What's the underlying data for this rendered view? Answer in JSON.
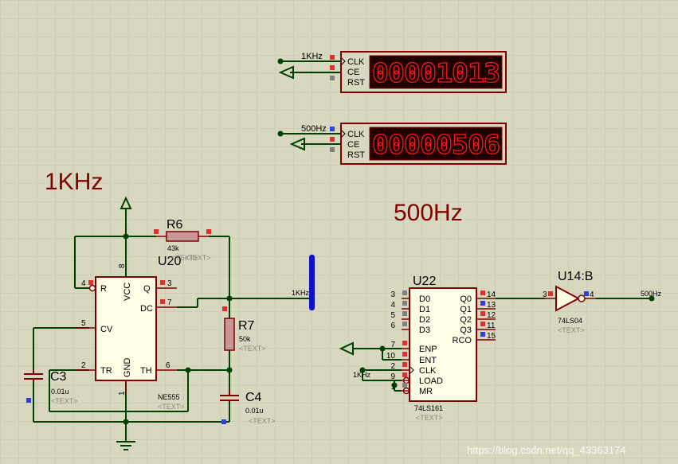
{
  "colors": {
    "background": "#d8d8c0",
    "wire": "#004000",
    "component": "#800000",
    "component_fill": "#ffffe8",
    "display_bg": "#200000",
    "display_segments": "#ff1a1a",
    "probe": "#1010c8"
  },
  "headings": {
    "left": "1KHz",
    "right": "500Hz"
  },
  "counter1": {
    "input_label": "1KHz",
    "pins": [
      "CLK",
      "CE",
      "RST"
    ],
    "display_value": "00001013"
  },
  "counter2": {
    "input_label": "500Hz",
    "pins": [
      "CLK",
      "CE",
      "RST"
    ],
    "display_value": "00000506"
  },
  "u20": {
    "ref": "U20",
    "type": "NE555",
    "text_placeholder": "<TEXT>",
    "pin_labels": [
      "R",
      "Q",
      "DC",
      "CV",
      "TR",
      "TH",
      "VCC",
      "GND"
    ],
    "pin_numbers": [
      "4",
      "3",
      "7",
      "5",
      "2",
      "6",
      "8",
      "1"
    ]
  },
  "r6": {
    "ref": "R6",
    "value": "43k",
    "text_placeholder": "<TEXT>"
  },
  "r7": {
    "ref": "R7",
    "value": "50k",
    "text_placeholder": "<TEXT>"
  },
  "c3": {
    "ref": "C3",
    "value": "0.01u",
    "text_placeholder": "<TEXT>"
  },
  "c4": {
    "ref": "C4",
    "value": "0.01u",
    "text_placeholder": "<TEXT>"
  },
  "probe_1k": {
    "label": "1KHz"
  },
  "u22": {
    "ref": "U22",
    "type": "74LS161",
    "text_placeholder": "<TEXT>",
    "left_pins": [
      {
        "num": "3",
        "label": "D0"
      },
      {
        "num": "4",
        "label": "D1"
      },
      {
        "num": "5",
        "label": "D2"
      },
      {
        "num": "6",
        "label": "D3"
      },
      {
        "num": "7",
        "label": "ENP"
      },
      {
        "num": "10",
        "label": "ENT"
      },
      {
        "num": "2",
        "label": "CLK"
      },
      {
        "num": "9",
        "label": "LOAD"
      },
      {
        "num": "1",
        "label": "MR"
      }
    ],
    "right_pins": [
      {
        "num": "14",
        "label": "Q0"
      },
      {
        "num": "13",
        "label": "Q1"
      },
      {
        "num": "12",
        "label": "Q2"
      },
      {
        "num": "11",
        "label": "Q3"
      },
      {
        "num": "15",
        "label": "RCO"
      }
    ],
    "clk_net_label": "1KHz"
  },
  "u14": {
    "ref": "U14:B",
    "type": "74LS04",
    "text_placeholder": "<TEXT>",
    "in_pin": "3",
    "out_pin": "4",
    "out_label": "500Hz"
  },
  "watermark": "https://blog.csdn.net/qq_43363174"
}
